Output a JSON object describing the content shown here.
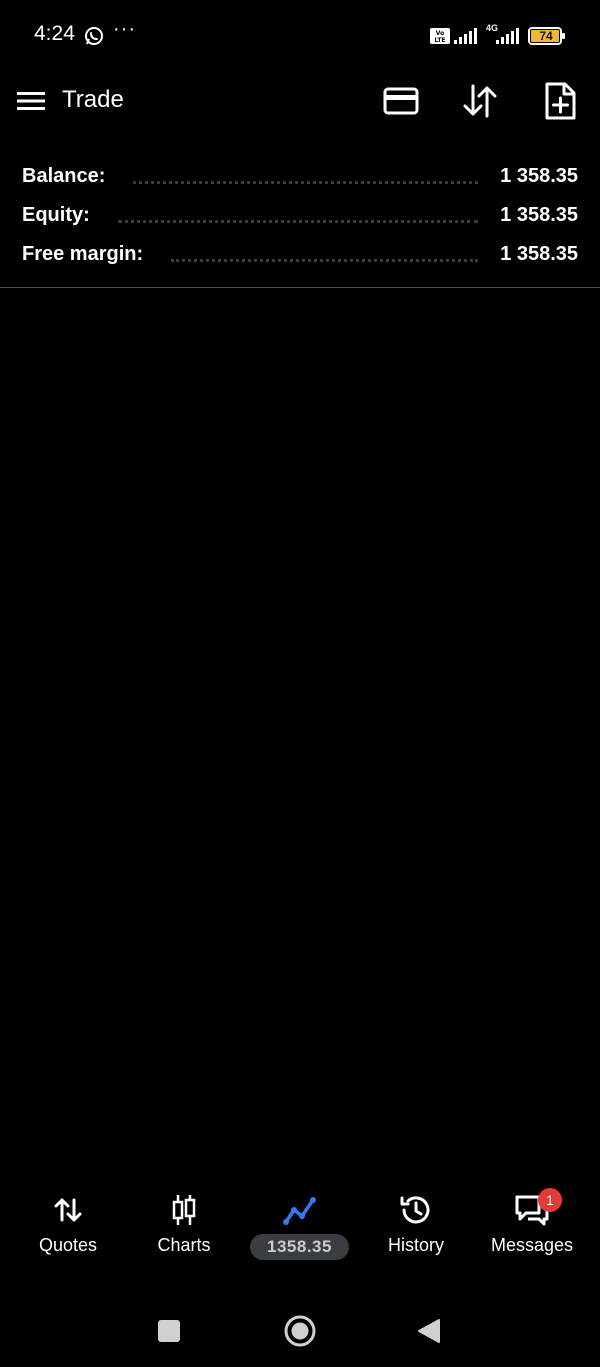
{
  "status_bar": {
    "time": "4:24",
    "more": "···",
    "network_type": "4G",
    "battery_level": "74",
    "icons": [
      "whatsapp-icon",
      "volte-icon",
      "signal-icon",
      "battery-icon"
    ]
  },
  "app_bar": {
    "title": "Trade",
    "icons": [
      "menu-icon",
      "credit-card-icon",
      "sort-icon",
      "new-order-icon"
    ]
  },
  "account": {
    "rows": [
      {
        "label": "Balance:",
        "value": "1 358.35"
      },
      {
        "label": "Equity:",
        "value": "1 358.35"
      },
      {
        "label": "Free margin:",
        "value": "1 358.35"
      }
    ]
  },
  "bottom_nav": {
    "items": [
      {
        "label": "Quotes",
        "icon": "quotes-arrows-icon"
      },
      {
        "label": "Charts",
        "icon": "candlestick-icon"
      },
      {
        "label": "1358.35",
        "icon": "trade-line-icon",
        "active": true
      },
      {
        "label": "History",
        "icon": "history-icon"
      },
      {
        "label": "Messages",
        "icon": "messages-icon",
        "badge": "1"
      }
    ]
  },
  "colors": {
    "background": "#000000",
    "accent": "#2f7bf5",
    "badge": "#e53935",
    "active_pill": "#3a3d42"
  }
}
